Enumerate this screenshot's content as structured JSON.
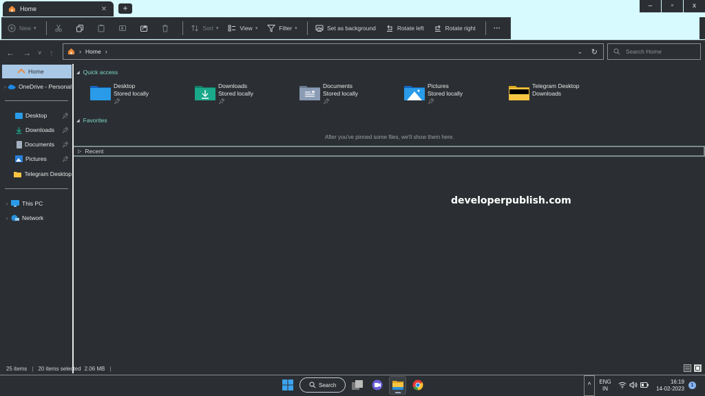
{
  "window": {
    "tab_title": "Home",
    "new_tab_label": "+",
    "controls": {
      "minimize": "–",
      "maximize": "▫",
      "close": "x"
    }
  },
  "toolbar": {
    "new_label": "New",
    "cut_icon": "scissors-icon",
    "copy_icon": "copy-icon",
    "paste_icon": "paste-icon",
    "rename_icon": "rename-icon",
    "share_icon": "share-icon",
    "delete_icon": "trash-icon",
    "sort_label": "Sort",
    "view_label": "View",
    "filter_label": "Filter",
    "set_background_label": "Set as background",
    "rotate_left_label": "Rotate left",
    "rotate_right_label": "Rotate right",
    "more_label": "···"
  },
  "nav": {
    "back": "←",
    "forward": "→",
    "recent": "˅",
    "up": "↑",
    "breadcrumb": [
      "Home"
    ],
    "search_placeholder": "Search Home"
  },
  "sidebar": {
    "items": [
      {
        "label": "Home",
        "selected": true
      },
      {
        "label": "OneDrive - Personal",
        "expandable": true
      },
      {
        "label": "Desktop",
        "pinned": true
      },
      {
        "label": "Downloads",
        "pinned": true
      },
      {
        "label": "Documents",
        "pinned": true
      },
      {
        "label": "Pictures",
        "pinned": true
      },
      {
        "label": "Telegram Desktop",
        "pinned": false
      },
      {
        "label": "This PC",
        "expandable": true
      },
      {
        "label": "Network",
        "expandable": true
      }
    ]
  },
  "main": {
    "quick_access_label": "Quick access",
    "quick_access": [
      {
        "name": "Desktop",
        "sub": "Stored locally",
        "pinned": true,
        "color": "#1e90e8"
      },
      {
        "name": "Downloads",
        "sub": "Stored locally",
        "pinned": true,
        "color": "#1aa88a"
      },
      {
        "name": "Documents",
        "sub": "Stored locally",
        "pinned": true,
        "color": "#8a9bb4"
      },
      {
        "name": "Pictures",
        "sub": "Stored locally",
        "pinned": true,
        "color": "#1e90e8"
      },
      {
        "name": "Telegram Desktop",
        "sub": "Downloads",
        "pinned": false,
        "color": "#f5c542"
      }
    ],
    "favorites_label": "Favorites",
    "favorites_empty": "After you've pinned some files, we'll show them here.",
    "recent_label": "Recent",
    "watermark": "developerpublish.com"
  },
  "status": {
    "items_count": "25 items",
    "selected": "20 items selected",
    "size": "2.06 MB"
  },
  "taskbar": {
    "search_label": "Search",
    "lang_top": "ENG",
    "lang_bottom": "IN",
    "time": "16:19",
    "date": "14-02-2023",
    "notification_count": "1"
  },
  "colors": {
    "accent_teal": "#7fd6c6",
    "titlebar_bg": "#d6fafe",
    "window_bg": "#2b2f33",
    "selection": "#a9c8e6"
  }
}
